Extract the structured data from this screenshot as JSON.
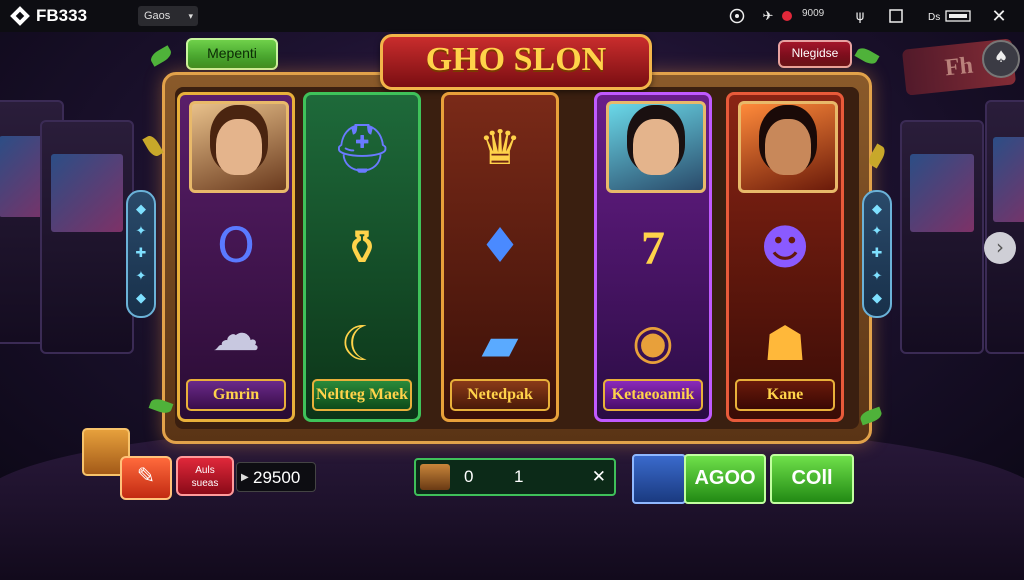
{
  "topbar": {
    "brand": "FB333",
    "tab_label": "Gaos",
    "coins": "9009"
  },
  "game": {
    "title": "GHO SLON",
    "badge_left": "Mepenti",
    "badge_right": "Nlegidse",
    "neon_sign": "Fh"
  },
  "reels": [
    {
      "label": "Gmrin",
      "color": "#4a1a5a"
    },
    {
      "label": "Neltteg Maek",
      "color": "#1a5a2a"
    },
    {
      "label": "Netedpak",
      "color": "#7a2a14"
    },
    {
      "label": "Ketaeoamik",
      "color": "#4a1a6a"
    },
    {
      "label": "Kane",
      "color": "#7a1a10"
    }
  ],
  "controls": {
    "btn_small_label": "Auls\nsueas",
    "balance": "29500",
    "bet_value": "0",
    "bet_lines": "1",
    "btn_agoo": "AGOO",
    "btn_coll": "COll"
  },
  "icons": [
    "fb-logo-icon",
    "target-icon",
    "bird-icon",
    "record-icon",
    "wifi-icon",
    "square-icon",
    "battery-icon",
    "close-icon",
    "shell-icon",
    "chevron-right-icon",
    "crate-icon"
  ]
}
